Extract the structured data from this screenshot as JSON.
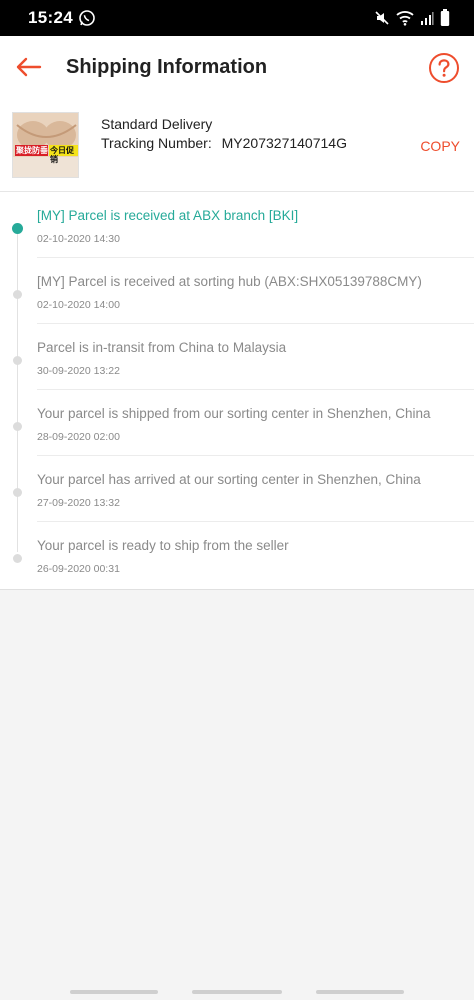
{
  "status_bar": {
    "time": "15:24"
  },
  "header": {
    "title": "Shipping Information"
  },
  "shipment": {
    "delivery_type": "Standard Delivery",
    "tracking_label": "Tracking Number:",
    "tracking_number": "MY207327140714G",
    "copy_label": "COPY",
    "thumb_text_1": "聚拢防垂",
    "thumb_text_2": "今日促销"
  },
  "timeline": [
    {
      "status": "[MY] Parcel is received at ABX branch [BKI]",
      "time": "02-10-2020 14:30",
      "active": true
    },
    {
      "status": "[MY] Parcel is received at sorting hub (ABX:SHX05139788CMY)",
      "time": "02-10-2020 14:00",
      "active": false
    },
    {
      "status": "Parcel is in-transit from China to Malaysia",
      "time": "30-09-2020 13:22",
      "active": false
    },
    {
      "status": "Your parcel is shipped from our sorting center in Shenzhen, China",
      "time": "28-09-2020 02:00",
      "active": false
    },
    {
      "status": "Your parcel has arrived at our sorting center in Shenzhen, China",
      "time": "27-09-2020 13:32",
      "active": false
    },
    {
      "status": "Your parcel is ready to ship from the seller",
      "time": "26-09-2020 00:31",
      "active": false
    }
  ],
  "colors": {
    "accent": "#ee4d2d",
    "active_status": "#26aa99",
    "muted": "#8a8a8a"
  },
  "icons": [
    "whatsapp-icon",
    "mute-icon",
    "wifi-icon",
    "signal-icon",
    "battery-icon",
    "back-arrow-icon",
    "help-circle-icon"
  ]
}
